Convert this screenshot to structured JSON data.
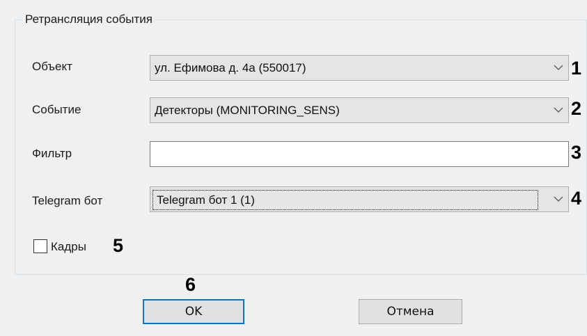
{
  "group": {
    "title": "Ретрансляция события"
  },
  "fields": {
    "object": {
      "label": "Объект",
      "value": "ул. Ефимова д. 4а (550017)",
      "callout": "1"
    },
    "event": {
      "label": "Событие",
      "value": "Детекторы (MONITORING_SENS)",
      "callout": "2"
    },
    "filter": {
      "label": "Фильтр",
      "value": "",
      "callout": "3"
    },
    "telegram": {
      "label": "Telegram бот",
      "value": "Telegram бот 1 (1)",
      "callout": "4"
    },
    "frames": {
      "label": "Кадры",
      "checked": false,
      "callout": "5"
    }
  },
  "buttons": {
    "ok": {
      "label": "OK",
      "callout": "6"
    },
    "cancel": {
      "label": "Отмена"
    }
  },
  "colors": {
    "default_button_border": "#0078d7",
    "dialog_bg": "#f0f0f0"
  }
}
